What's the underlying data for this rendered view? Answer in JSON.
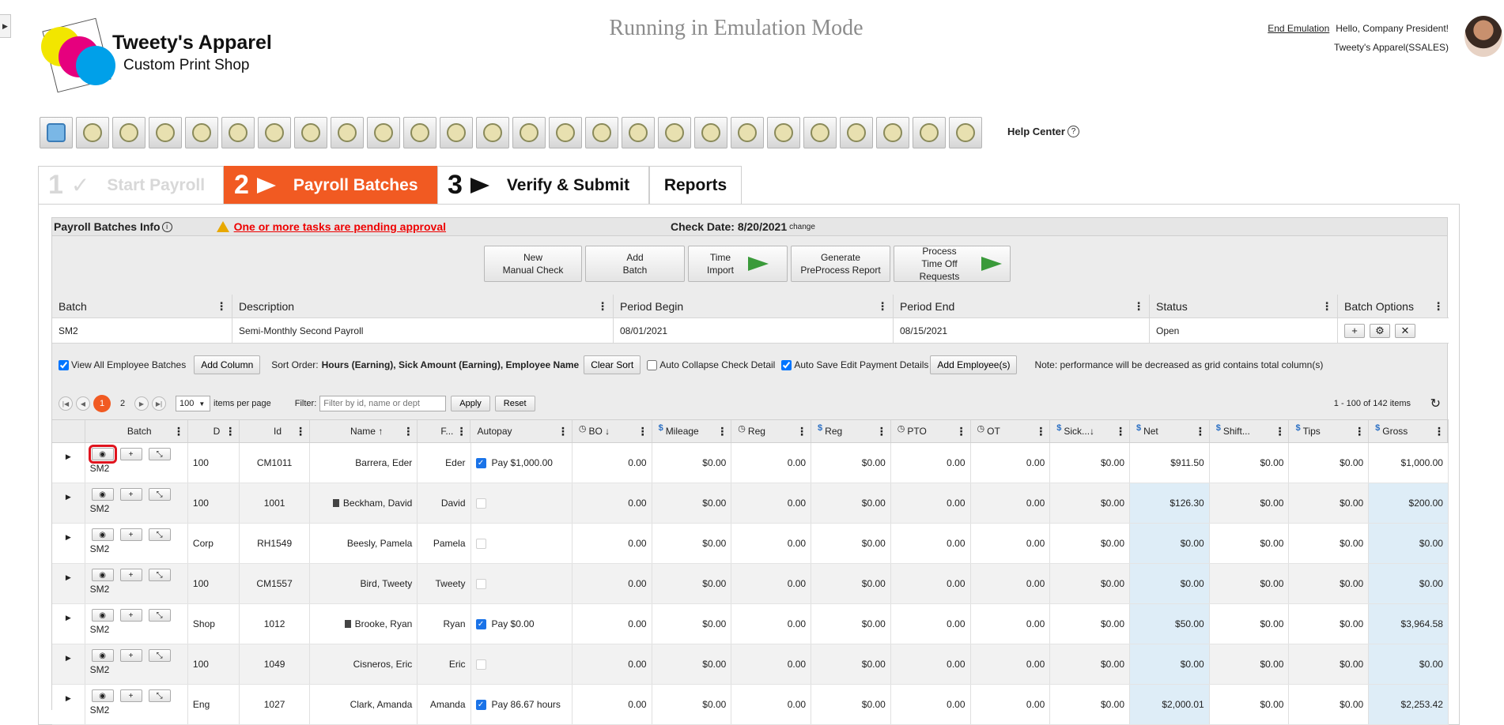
{
  "header": {
    "company_name": "Tweety's Apparel",
    "company_sub": "Custom Print Shop",
    "emulation_text": "Running in Emulation Mode",
    "end_emulation": "End Emulation",
    "greeting": "Hello, Company President!",
    "company_code": "Tweety's Apparel(SSALES)",
    "logo_colors": [
      "#f2e600",
      "#e6007e",
      "#00a0e9"
    ]
  },
  "toolbar": {
    "icons": [
      "home-icon",
      "target-icon",
      "gears-icon",
      "presentation-icon",
      "group-search-icon",
      "team-icon",
      "org-chart-icon",
      "document-icon",
      "money-bag-icon",
      "crosshair-icon",
      "crosshair-icon",
      "crosshair-icon",
      "crosshair-icon",
      "tools-icon",
      "hand-icon",
      "shield-icon",
      "hand-search-icon",
      "target-x-icon",
      "money-bag-icon",
      "team-chart-icon",
      "hand-icon",
      "team-board-icon",
      "hand-search-icon",
      "gift-icon",
      "team-board-icon",
      "settings-icon"
    ],
    "help_label": "Help Center",
    "help_q": "?"
  },
  "steps": [
    {
      "num": "1",
      "check": "✓",
      "label": "Start Payroll"
    },
    {
      "num": "2",
      "label": "Payroll Batches"
    },
    {
      "num": "3",
      "label": "Verify & Submit"
    },
    {
      "label": "Reports"
    }
  ],
  "info": {
    "title": "Payroll Batches Info",
    "info_i": "i",
    "warning": "One or more tasks are pending approval",
    "check_date": "Check Date: 8/20/2021",
    "change": "change"
  },
  "actions": {
    "new_manual_check": [
      "New",
      "Manual Check"
    ],
    "add_batch": [
      "Add",
      "Batch"
    ],
    "time_import": [
      "Time",
      "Import"
    ],
    "generate_report": [
      "Generate",
      "PreProcess Report"
    ],
    "process_time_off": [
      "Process",
      "Time Off Requests"
    ]
  },
  "batch_table": {
    "headers": [
      "Batch",
      "Description",
      "Period Begin",
      "Period End",
      "Status",
      "Batch Options"
    ],
    "row": {
      "batch": "SM2",
      "description": "Semi-Monthly Second Payroll",
      "period_begin": "08/01/2021",
      "period_end": "08/15/2021",
      "status": "Open"
    },
    "options": [
      "+",
      "⚙",
      "✕"
    ]
  },
  "grid_options": {
    "view_all_label": "View All Employee Batches",
    "add_column": "Add Column",
    "sort_prefix": "Sort Order:",
    "sort_value": "Hours (Earning), Sick Amount (Earning), Employee Name",
    "clear_sort": "Clear Sort",
    "auto_collapse": "Auto Collapse Check Detail",
    "auto_save": "Auto Save Edit Payment Details",
    "add_employees": "Add Employee(s)",
    "note": "Note: performance will be decreased as grid contains total column(s)"
  },
  "pager": {
    "page1": "1",
    "page2": "2",
    "per_page": "100",
    "per_page_label": "items per page",
    "filter_label": "Filter:",
    "filter_placeholder": "Filter by id, name or dept",
    "apply": "Apply",
    "reset": "Reset",
    "total": "1 - 100 of 142 items"
  },
  "grid": {
    "headers": [
      {
        "label": "Batch",
        "icon": ""
      },
      {
        "label": "D",
        "icon": ""
      },
      {
        "label": "Id",
        "icon": ""
      },
      {
        "label": "Name ↑",
        "icon": ""
      },
      {
        "label": "F...",
        "icon": ""
      },
      {
        "label": "Autopay",
        "icon": ""
      },
      {
        "label": "BO ↓",
        "icon": "clock"
      },
      {
        "label": "Mileage",
        "icon": "dollar"
      },
      {
        "label": "Reg",
        "icon": "clock"
      },
      {
        "label": "Reg",
        "icon": "dollar"
      },
      {
        "label": "PTO",
        "icon": "clock"
      },
      {
        "label": "OT",
        "icon": "clock"
      },
      {
        "label": "Sick...↓",
        "icon": "dollar"
      },
      {
        "label": "Net",
        "icon": "dollar"
      },
      {
        "label": "Shift...",
        "icon": "dollar"
      },
      {
        "label": "Tips",
        "icon": "dollar"
      },
      {
        "label": "Gross",
        "icon": "dollar"
      }
    ],
    "rows": [
      {
        "batch": "SM2",
        "dept": "100",
        "id": "CM1011",
        "name": "Barrera, Eder",
        "first": "Eder",
        "autopay_on": true,
        "autopay": "Pay $1,000.00",
        "doc": false,
        "bo": "0.00",
        "mileage": "$0.00",
        "reg_h": "0.00",
        "reg_d": "$0.00",
        "pto": "0.00",
        "ot": "0.00",
        "sick": "$0.00",
        "net": "$911.50",
        "shift": "$0.00",
        "tips": "$0.00",
        "gross": "$1,000.00",
        "hl": false
      },
      {
        "batch": "SM2",
        "dept": "100",
        "id": "1001",
        "name": "Beckham, David",
        "first": "David",
        "autopay_on": false,
        "autopay": "",
        "doc": true,
        "bo": "0.00",
        "mileage": "$0.00",
        "reg_h": "0.00",
        "reg_d": "$0.00",
        "pto": "0.00",
        "ot": "0.00",
        "sick": "$0.00",
        "net": "$126.30",
        "shift": "$0.00",
        "tips": "$0.00",
        "gross": "$200.00",
        "hl": true
      },
      {
        "batch": "SM2",
        "dept": "Corp",
        "id": "RH1549",
        "name": "Beesly, Pamela",
        "first": "Pamela",
        "autopay_on": false,
        "autopay": "",
        "doc": false,
        "bo": "0.00",
        "mileage": "$0.00",
        "reg_h": "0.00",
        "reg_d": "$0.00",
        "pto": "0.00",
        "ot": "0.00",
        "sick": "$0.00",
        "net": "$0.00",
        "shift": "$0.00",
        "tips": "$0.00",
        "gross": "$0.00",
        "hl": true
      },
      {
        "batch": "SM2",
        "dept": "100",
        "id": "CM1557",
        "name": "Bird, Tweety",
        "first": "Tweety",
        "autopay_on": false,
        "autopay": "",
        "doc": false,
        "bo": "0.00",
        "mileage": "$0.00",
        "reg_h": "0.00",
        "reg_d": "$0.00",
        "pto": "0.00",
        "ot": "0.00",
        "sick": "$0.00",
        "net": "$0.00",
        "shift": "$0.00",
        "tips": "$0.00",
        "gross": "$0.00",
        "hl": true
      },
      {
        "batch": "SM2",
        "dept": "Shop",
        "id": "1012",
        "name": "Brooke, Ryan",
        "first": "Ryan",
        "autopay_on": true,
        "autopay": "Pay $0.00",
        "doc": true,
        "bo": "0.00",
        "mileage": "$0.00",
        "reg_h": "0.00",
        "reg_d": "$0.00",
        "pto": "0.00",
        "ot": "0.00",
        "sick": "$0.00",
        "net": "$50.00",
        "shift": "$0.00",
        "tips": "$0.00",
        "gross": "$3,964.58",
        "hl": true
      },
      {
        "batch": "SM2",
        "dept": "100",
        "id": "1049",
        "name": "Cisneros, Eric",
        "first": "Eric",
        "autopay_on": false,
        "autopay": "",
        "doc": false,
        "bo": "0.00",
        "mileage": "$0.00",
        "reg_h": "0.00",
        "reg_d": "$0.00",
        "pto": "0.00",
        "ot": "0.00",
        "sick": "$0.00",
        "net": "$0.00",
        "shift": "$0.00",
        "tips": "$0.00",
        "gross": "$0.00",
        "hl": true
      },
      {
        "batch": "SM2",
        "dept": "Eng",
        "id": "1027",
        "name": "Clark, Amanda",
        "first": "Amanda",
        "autopay_on": true,
        "autopay": "Pay 86.67 hours",
        "doc": false,
        "bo": "0.00",
        "mileage": "$0.00",
        "reg_h": "0.00",
        "reg_d": "$0.00",
        "pto": "0.00",
        "ot": "0.00",
        "sick": "$0.00",
        "net": "$2,000.01",
        "shift": "$0.00",
        "tips": "$0.00",
        "gross": "$2,253.42",
        "hl": true
      }
    ]
  },
  "colors": {
    "accent": "#f15a22",
    "warning": "#e00000",
    "highlight": "#deedf7",
    "arrow_green": "#3a9a3a"
  }
}
